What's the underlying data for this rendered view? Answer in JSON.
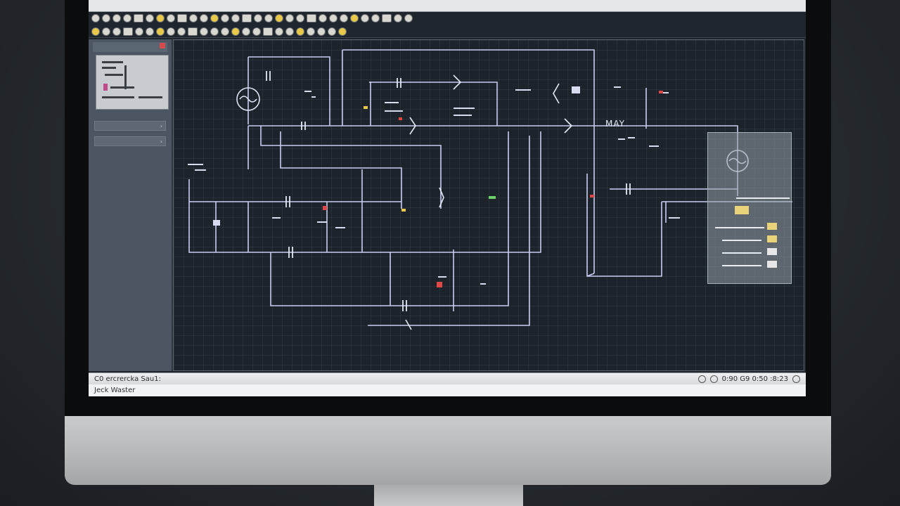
{
  "status": {
    "left_text": "C0 ercrercka Sau1:",
    "right_text": "0:90 G9 0:50 :8:23",
    "bottom_text": "Jeck Waster"
  },
  "canvas": {
    "labels": {
      "wave_label": "MAY"
    }
  },
  "colors": {
    "canvas_bg": "#1c232b",
    "wire": "#c8cdf0",
    "accent_red": "#e04848",
    "accent_yellow": "#e8c94a"
  }
}
